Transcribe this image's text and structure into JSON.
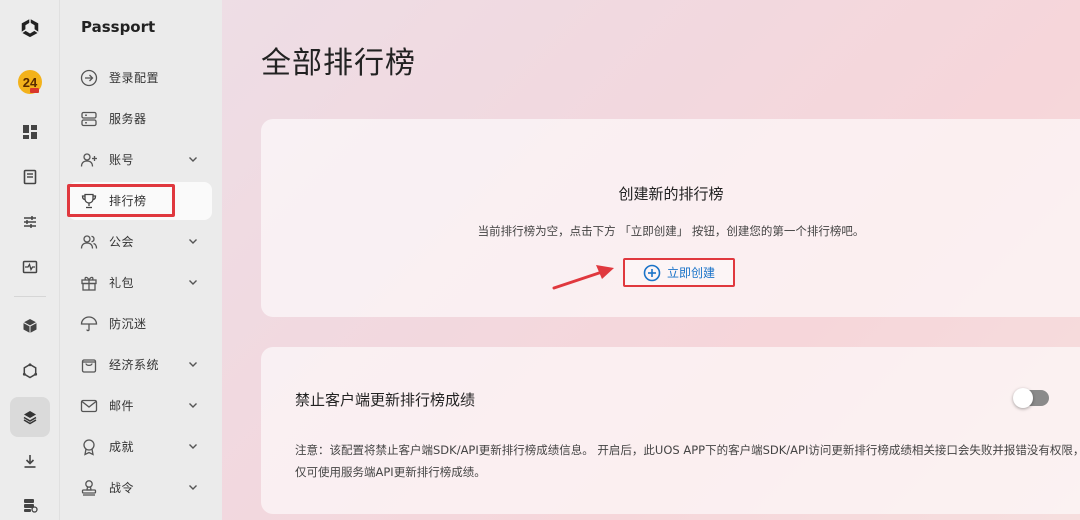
{
  "sidebar": {
    "title": "Passport",
    "items": [
      {
        "label": "登录配置",
        "icon": "arrow-right-circle-icon",
        "has_chevron": false
      },
      {
        "label": "服务器",
        "icon": "server-icon",
        "has_chevron": false
      },
      {
        "label": "账号",
        "icon": "user-plus-icon",
        "has_chevron": true
      },
      {
        "label": "排行榜",
        "icon": "trophy-icon",
        "has_chevron": false,
        "active": true
      },
      {
        "label": "公会",
        "icon": "users-icon",
        "has_chevron": true
      },
      {
        "label": "礼包",
        "icon": "gift-icon",
        "has_chevron": true
      },
      {
        "label": "防沉迷",
        "icon": "umbrella-icon",
        "has_chevron": false
      },
      {
        "label": "经济系统",
        "icon": "shopping-bag-icon",
        "has_chevron": true
      },
      {
        "label": "邮件",
        "icon": "mail-icon",
        "has_chevron": true
      },
      {
        "label": "成就",
        "icon": "award-icon",
        "has_chevron": true
      },
      {
        "label": "战令",
        "icon": "stamp-icon",
        "has_chevron": true
      }
    ]
  },
  "rail": {
    "icons": [
      "unity-logo-icon",
      "app-24-logo-icon",
      "dashboard-icon",
      "book-icon",
      "sliders-icon",
      "monitor-pulse-icon",
      "package-icon",
      "hexagon-icon",
      "layers-icon",
      "download-icon",
      "database-settings-icon"
    ]
  },
  "main": {
    "page_title": "全部排行榜",
    "empty_card": {
      "title": "创建新的排行榜",
      "description": "当前排行榜为空，点击下方 「立即创建」 按钮，创建您的第一个排行榜吧。",
      "create_button_label": "立即创建"
    },
    "setting_card": {
      "title": "禁止客户端更新排行榜成绩",
      "toggle_on": false,
      "note": "注意：该配置将禁止客户端SDK/API更新排行榜成绩信息。 开启后，此UOS APP下的客户端SDK/API访问更新排行榜成绩相关接口会失败并报错没有权限，仅可使用服务端API更新排行榜成绩。"
    }
  },
  "colors": {
    "highlight": "#e0383e",
    "link": "#1a73c8"
  }
}
